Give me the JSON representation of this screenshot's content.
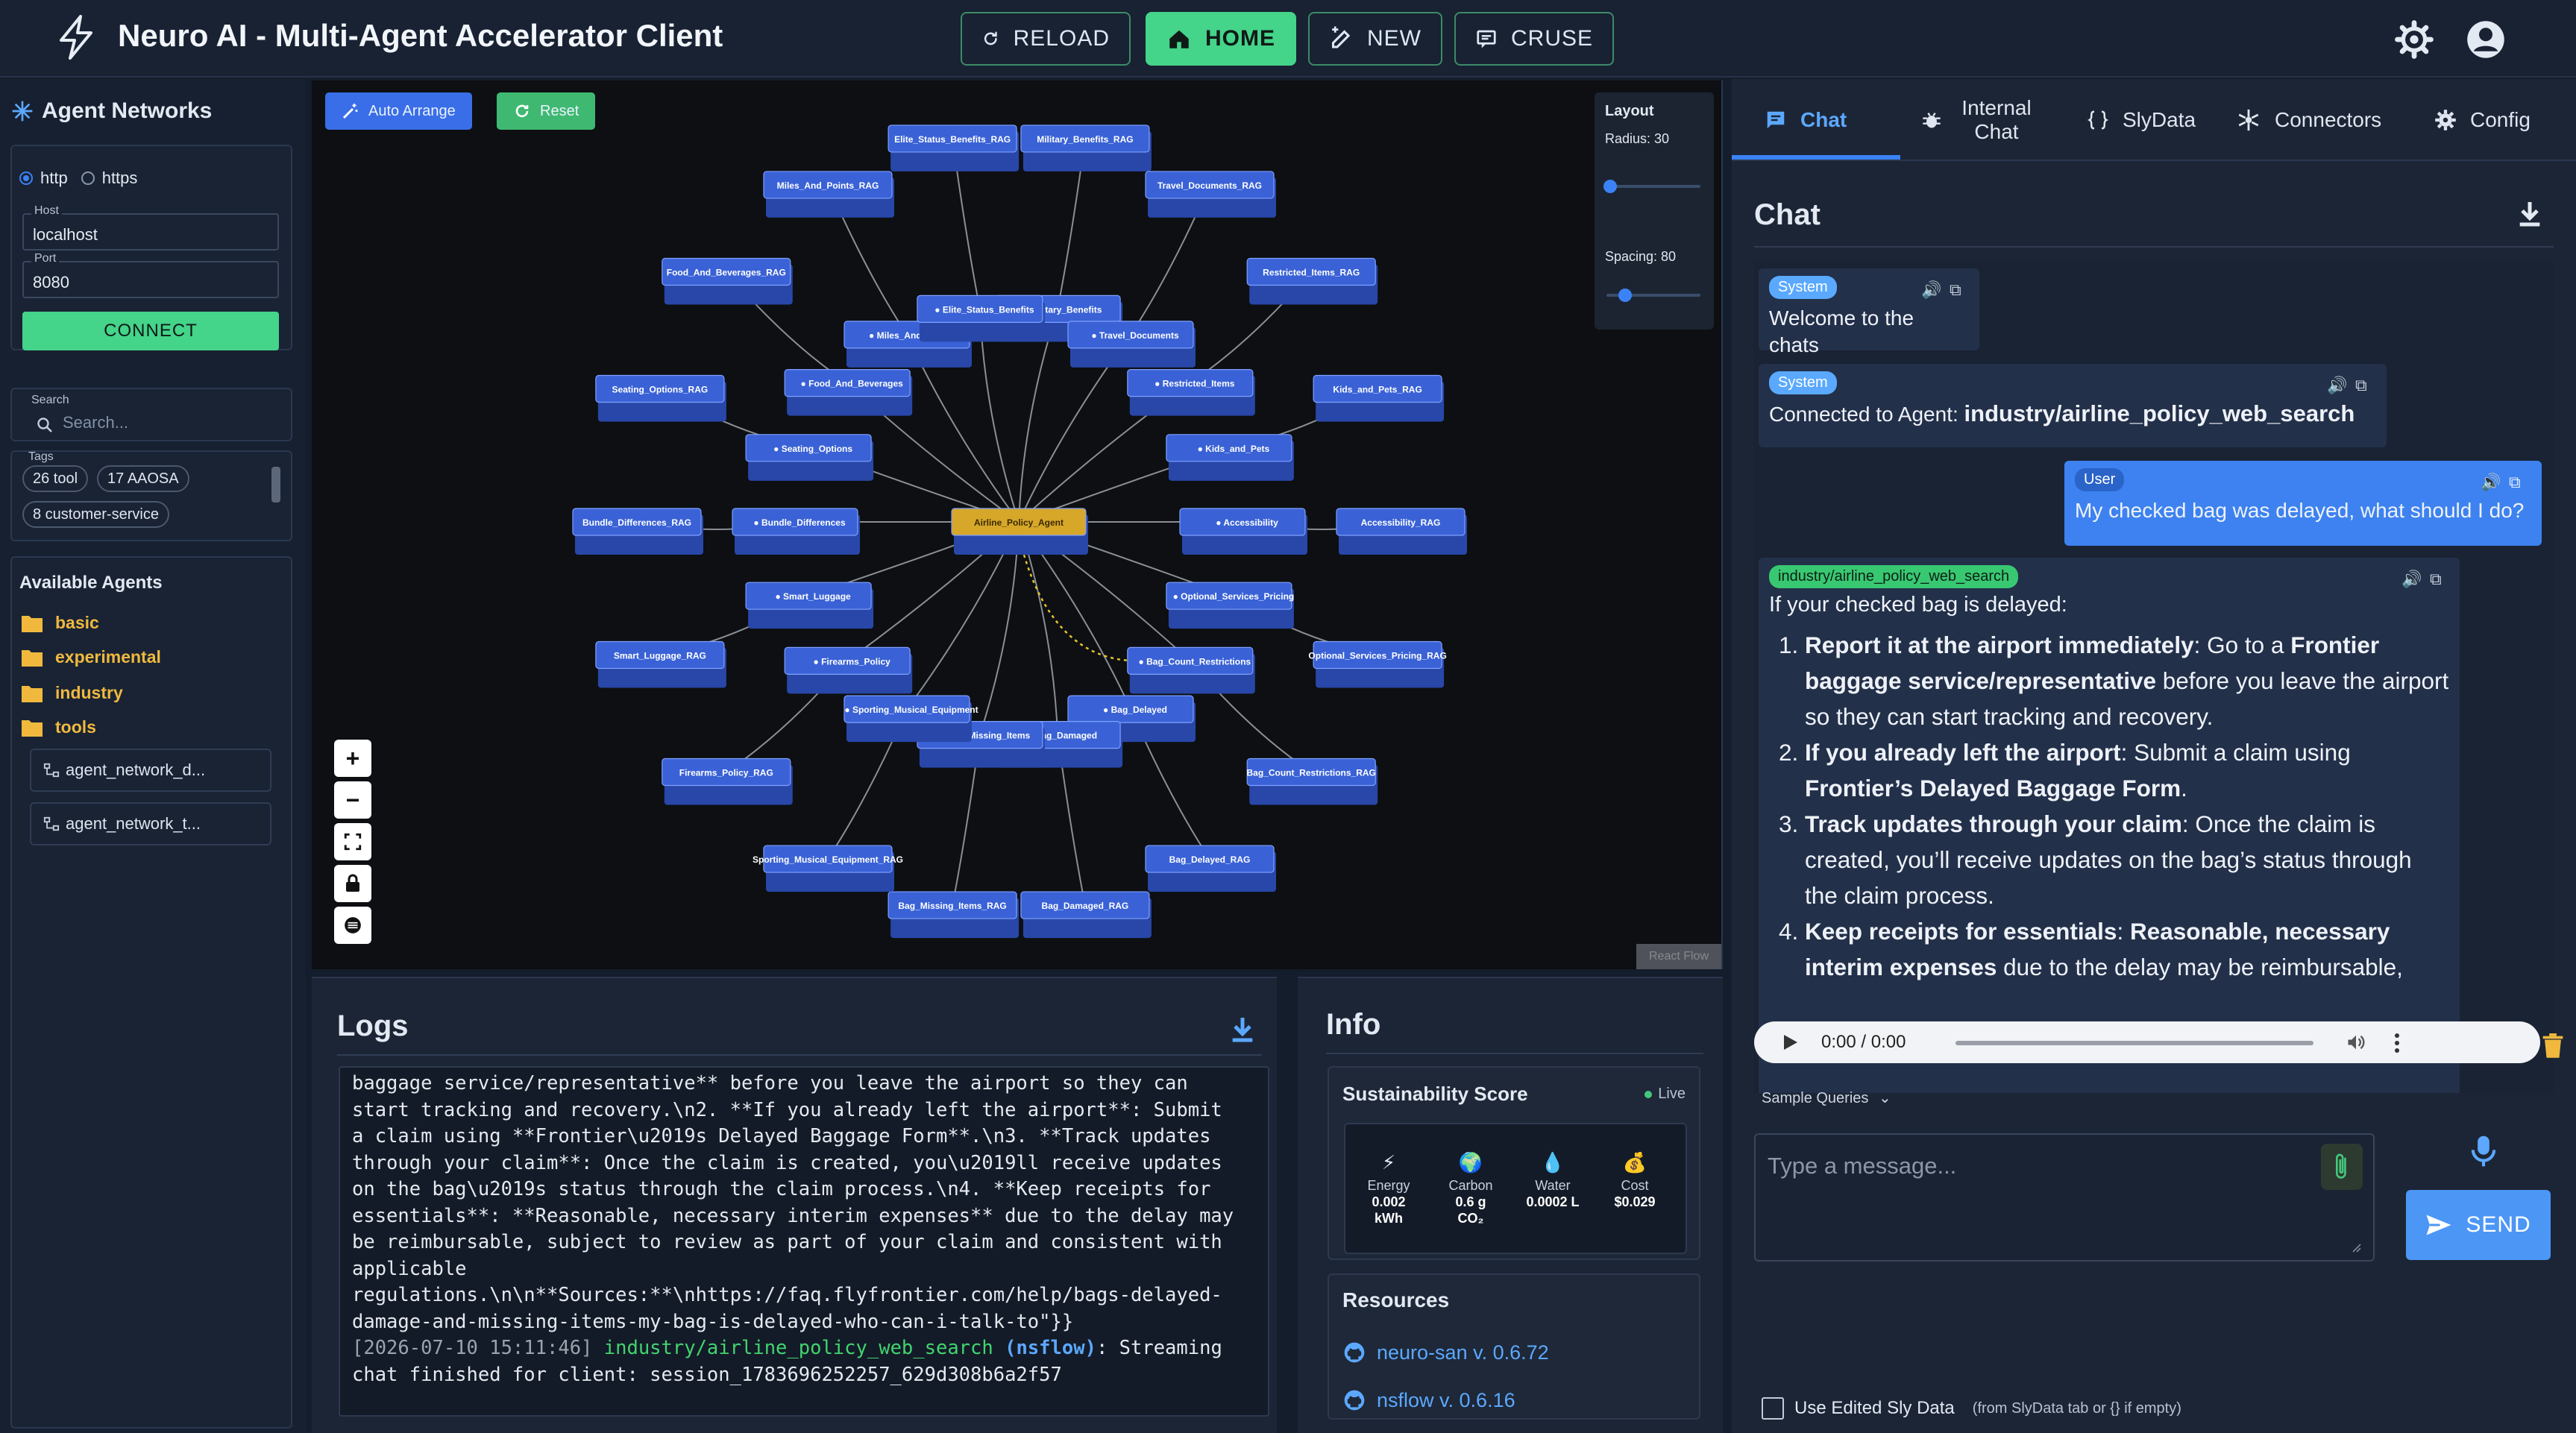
{
  "header": {
    "title": "Neuro AI - Multi-Agent Accelerator Client",
    "buttons": {
      "reload": "RELOAD",
      "home": "HOME",
      "new": "NEW",
      "cruse": "CRUSE"
    },
    "accent": "#44d48a"
  },
  "sidebar": {
    "title": "Agent Networks",
    "protocols": [
      "http",
      "https"
    ],
    "selected_protocol": "http",
    "host_label": "Host",
    "host_value": "localhost",
    "port_label": "Port",
    "port_value": "8080",
    "connect_label": "CONNECT",
    "search_label": "Search",
    "search_placeholder": "Search...",
    "tags_label": "Tags",
    "tags": [
      "26 tool",
      "17 AAOSA",
      "8 customer-service"
    ],
    "available_title": "Available Agents",
    "folders": [
      "basic",
      "experimental",
      "industry",
      "tools"
    ],
    "networks": [
      "agent_network_d...",
      "agent_network_t..."
    ]
  },
  "graph": {
    "buttons": {
      "auto_arrange": "Auto Arrange",
      "reset": "Reset"
    },
    "layout": {
      "title": "Layout",
      "radius_label": "Radius: 30",
      "spacing_label": "Spacing: 80",
      "radius": 30,
      "spacing": 80
    },
    "center": "Airline_Policy_Agent",
    "inner_nodes": [
      "Military_Benefits",
      "Travel_Documents",
      "Restricted_Items",
      "Kids_and_Pets",
      "Accessibility",
      "Optional_Services_Pricing",
      "Bag_Count_Restrictions",
      "Bag_Delayed",
      "Bag_Damaged",
      "Bag_Missing_Items",
      "Sporting_Musical_Equipment",
      "Firearms_Policy",
      "Smart_Luggage",
      "Bundle_Differences",
      "Seating_Options",
      "Food_And_Beverages",
      "Miles_And_Points",
      "Elite_Status_Benefits"
    ],
    "outer_nodes": [
      "Military_Benefits_RAG",
      "Travel_Documents_RAG",
      "Restricted_Items_RAG",
      "Kids_and_Pets_RAG",
      "Accessibility_RAG",
      "Optional_Services_Pricing_RAG",
      "Bag_Count_Restrictions_RAG",
      "Bag_Delayed_RAG",
      "Bag_Damaged_RAG",
      "Bag_Missing_Items_RAG",
      "Sporting_Musical_Equipment_RAG",
      "Firearms_Policy_RAG",
      "Smart_Luggage_RAG",
      "Bundle_Differences_RAG",
      "Seating_Options_RAG",
      "Food_And_Beverages_RAG",
      "Miles_And_Points_RAG",
      "Elite_Status_Benefits_RAG"
    ],
    "node_color": "#3a62d6",
    "center_color": "#d7a72a",
    "watermark": "React Flow"
  },
  "logs": {
    "title": "Logs",
    "lines": [
      "baggage service/representative** before you leave the airport so they can",
      "start tracking and recovery.\\n2. **If you already left the airport**: Submit",
      "a claim using **Frontier\\u2019s Delayed Baggage Form**.\\n3. **Track updates",
      "through your claim**: Once the claim is created, you\\u2019ll receive updates",
      "on the bag\\u2019s status through the claim process.\\n4. **Keep receipts for",
      "essentials**: **Reasonable, necessary interim expenses** due to the delay may",
      "be reimbursable, subject to review as part of your claim and consistent with",
      "applicable",
      "regulations.\\n\\n**Sources:**\\nhttps://faq.flyfrontier.com/help/bags-delayed-",
      "damage-and-missing-items-my-bag-is-delayed-who-can-i-talk-to\"}}"
    ],
    "last_ts": "[2026-07-10 15:11:46]",
    "last_agent": "industry/airline_policy_web_search",
    "last_tag": "(nsflow)",
    "last_msg": ": Streaming",
    "last_line2": "chat finished for client: session_1783696252257_629d308b6a2f57"
  },
  "info": {
    "title": "Info",
    "sustainability_title": "Sustainability Score",
    "live": "Live",
    "metrics": [
      {
        "label": "Energy",
        "value": "0.002",
        "unit": "kWh"
      },
      {
        "label": "Carbon",
        "value": "0.6 g",
        "unit": "CO₂"
      },
      {
        "label": "Water",
        "value": "0.0002 L",
        "unit": ""
      },
      {
        "label": "Cost",
        "value": "$0.029",
        "unit": ""
      }
    ],
    "resources_title": "Resources",
    "resources": [
      "neuro-san v. 0.6.72",
      "nsflow v. 0.6.16"
    ]
  },
  "right": {
    "tabs": [
      "Chat",
      "Internal Chat",
      "SlyData",
      "Connectors",
      "Config"
    ],
    "chat_title": "Chat",
    "messages": {
      "m1_badge": "System",
      "m1_text": "Welcome to the chats",
      "m2_badge": "System",
      "m2_prefix": "Connected to Agent: ",
      "m2_agent": "industry/airline_policy_web_search",
      "m3_badge": "User",
      "m3_text": "My checked bag was delayed, what should I do?",
      "m4_badge": "industry/airline_policy_web_search",
      "m4_intro": "If your checked bag is delayed:",
      "m4_items": [
        {
          "b1": "Report it at the airport immediately",
          "t1": ": Go to a ",
          "b2": "Frontier baggage service/representative",
          "t2": " before you leave the airport so they can start tracking and recovery."
        },
        {
          "b1": "If you already left the airport",
          "t1": ": Submit a claim using ",
          "b2": "Frontier’s Delayed Baggage Form",
          "t2": "."
        },
        {
          "b1": "Track updates through your claim",
          "t1": ": Once the claim is created, you’ll receive updates on the bag’s status through the claim process.",
          "b2": "",
          "t2": ""
        },
        {
          "b1": "Keep receipts for essentials",
          "t1": ": ",
          "b2": "Reasonable, necessary interim expenses",
          "t2": " due to the delay may be reimbursable,"
        }
      ]
    },
    "audio_time": "0:00 / 0:00",
    "sample_queries": "Sample Queries",
    "input_placeholder": "Type a message...",
    "send_label": "SEND",
    "footer_label": "Use Edited Sly Data",
    "footer_hint": "(from SlyData tab or {} if empty)"
  }
}
